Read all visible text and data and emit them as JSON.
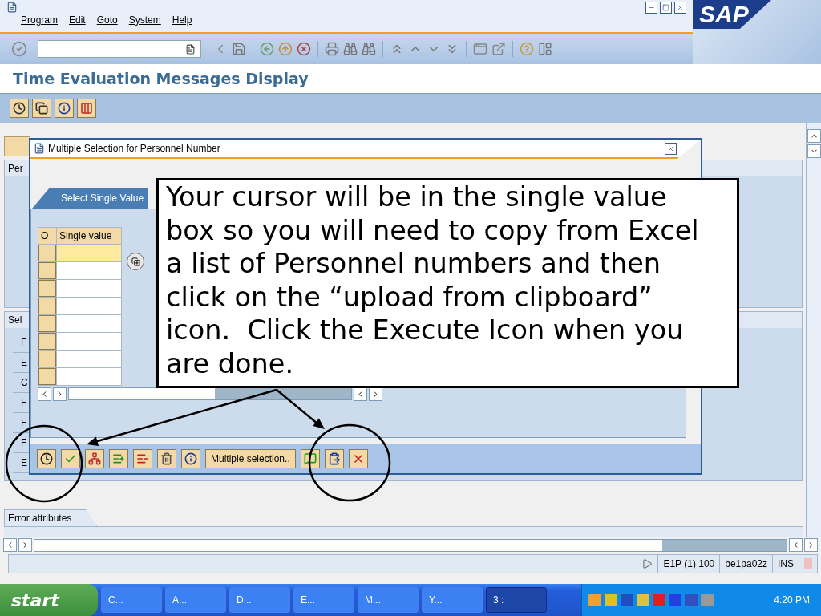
{
  "window": {
    "menu": [
      {
        "label": "Program"
      },
      {
        "label": "Edit"
      },
      {
        "label": "Goto"
      },
      {
        "label": "System"
      },
      {
        "label": "Help"
      }
    ],
    "logo": "SAP"
  },
  "screen_title": "Time Evaluation Messages Display",
  "background": {
    "frames": [
      {
        "label": "Per"
      },
      {
        "label": "Sel",
        "rows": [
          "F",
          "E",
          "C",
          "F",
          "F",
          "F",
          "E"
        ]
      }
    ],
    "tab": "Error attributes"
  },
  "dialog": {
    "title": "Multiple Selection for Personnel Number",
    "tabs": [
      {
        "label": "Select Single Value",
        "selected": true
      }
    ],
    "table": {
      "columns": [
        "O",
        "Single value"
      ],
      "rows": [
        {
          "focused": true
        },
        {
          "focused": false
        },
        {
          "focused": false
        },
        {
          "focused": false
        },
        {
          "focused": false
        },
        {
          "focused": false
        },
        {
          "focused": false
        },
        {
          "focused": false
        }
      ]
    },
    "toolbar_button": "Multiple selection.."
  },
  "callout": {
    "text": "Your cursor will be in the single value\nbox so you will need to copy from Excel\na list of Personnel numbers and then\nclick on the “upload from clipboard”\nicon.  Click the Execute Icon when you\nare done."
  },
  "status_bar": {
    "system": "E1P (1) 100",
    "server": "be1pa02z",
    "mode": "INS"
  },
  "taskbar": {
    "start": "start",
    "items": [
      {
        "label": "C...",
        "selected": false
      },
      {
        "label": "A...",
        "selected": false
      },
      {
        "label": "D...",
        "selected": false
      },
      {
        "label": "E...",
        "selected": false
      },
      {
        "label": "M...",
        "selected": false
      },
      {
        "label": "Y...",
        "selected": false
      },
      {
        "label": "3 :",
        "selected": true
      }
    ],
    "clock": "4:20 PM"
  }
}
